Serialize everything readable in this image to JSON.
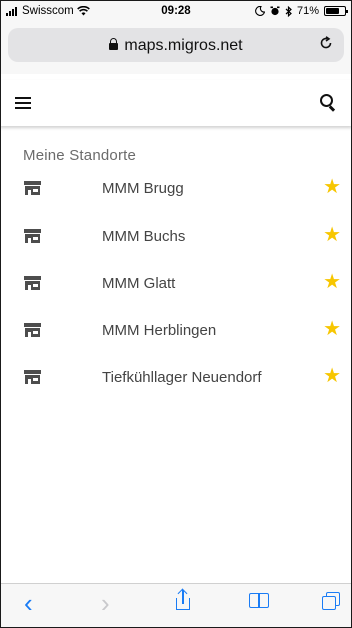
{
  "status_bar": {
    "carrier": "Swisscom",
    "time": "09:28",
    "battery": "71%",
    "battery_level": 0.71
  },
  "browser": {
    "url": "maps.migros.net",
    "reload_icon": "reload-icon",
    "lock_icon": "lock-icon"
  },
  "header": {
    "menu_icon": "hamburger-menu-icon",
    "search_icon": "search-icon"
  },
  "favorites": {
    "title": "Meine Standorte",
    "items": [
      {
        "label": "MMM Brugg"
      },
      {
        "label": "MMM Buchs"
      },
      {
        "label": "MMM Glatt"
      },
      {
        "label": "MMM Herblingen"
      },
      {
        "label": "Tiefkühllager Neuendorf"
      }
    ],
    "star_color": "#f7c600"
  },
  "toolbar": {
    "back": "‹",
    "forward": "›"
  },
  "colors": {
    "accent": "#1a7cf5",
    "star": "#f7c600"
  }
}
